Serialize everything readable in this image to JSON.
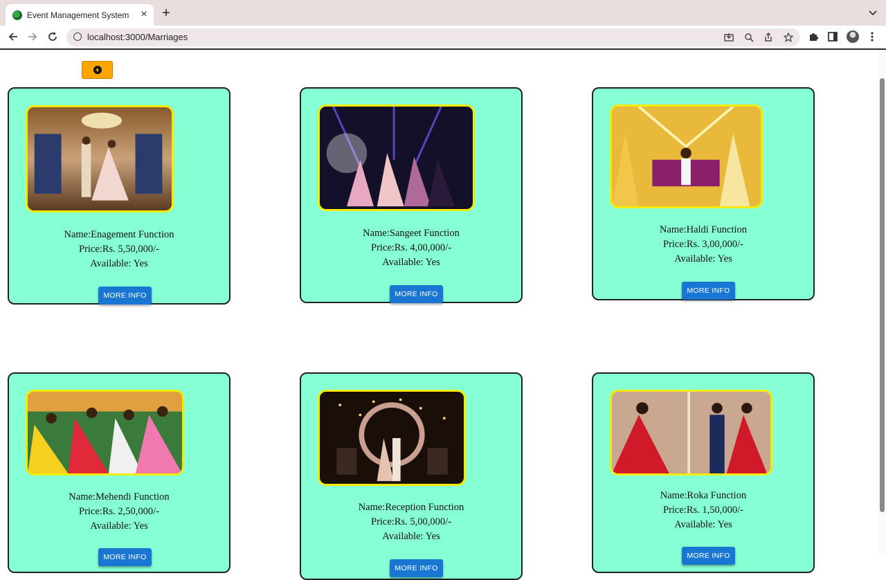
{
  "browser": {
    "tab_title": "Event Management System",
    "url": "localhost:3000/Marriages"
  },
  "cards": [
    {
      "name": "Name:Enagement Function",
      "price": "Price:Rs. 5,50,000/-",
      "available": "Available: Yes",
      "button": "MORE INFO"
    },
    {
      "name": "Name:Sangeet Function",
      "price": "Price:Rs. 4,00,000/-",
      "available": "Available: Yes",
      "button": "MORE INFO"
    },
    {
      "name": "Name:Haldi Function",
      "price": "Price:Rs. 3,00,000/-",
      "available": "Available: Yes",
      "button": "MORE INFO"
    },
    {
      "name": "Name:Mehendi Function",
      "price": "Price:Rs. 2,50,000/-",
      "available": "Available: Yes",
      "button": "MORE INFO"
    },
    {
      "name": "Name:Reception Function",
      "price": "Price:Rs. 5,00,000/-",
      "available": "Available: Yes",
      "button": "MORE INFO"
    },
    {
      "name": "Name:Roka Function",
      "price": "Price:Rs. 1,50,000/-",
      "available": "Available: Yes",
      "button": "MORE INFO"
    }
  ],
  "colors": {
    "card_bg": "#87ffd4",
    "image_border": "#f5ea00",
    "button": "#1976d2",
    "back_button": "#ffa500"
  }
}
